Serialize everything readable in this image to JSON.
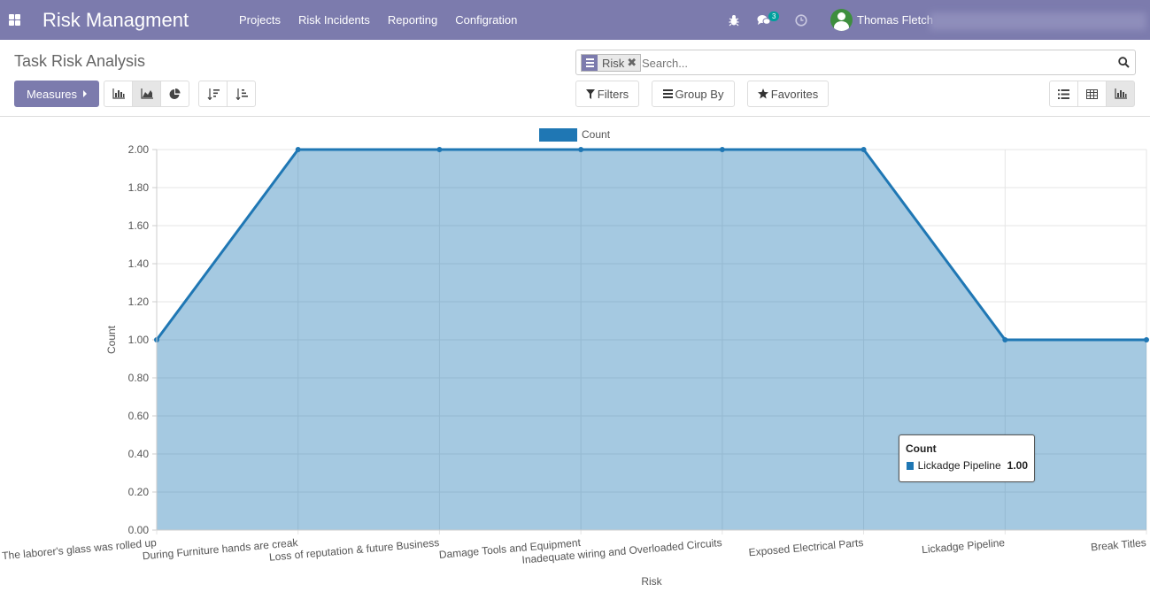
{
  "navbar": {
    "brand": "Risk Managment",
    "menu": [
      "Projects",
      "Risk Incidents",
      "Reporting",
      "Configration"
    ],
    "chat_count": "3",
    "user_name": "Thomas Fletch"
  },
  "control_panel": {
    "title": "Task Risk Analysis",
    "measures_label": "Measures",
    "search": {
      "facet": "Risk",
      "placeholder": "Search..."
    },
    "filters_label": "Filters",
    "groupby_label": "Group By",
    "favorites_label": "Favorites"
  },
  "chart_data": {
    "type": "area",
    "categories": [
      "The laborer's glass was rolled up",
      "During Furniture hands are creak",
      "Loss of reputation & future Business",
      "Damage Tools and Equipment",
      "Inadequate wiring and Overloaded Circuits",
      "Exposed Electrical Parts",
      "Lickadge Pipeline",
      "Break Titles"
    ],
    "series": [
      {
        "name": "Count",
        "values": [
          1,
          2,
          2,
          2,
          2,
          2,
          1,
          1
        ],
        "color": "#1f77b4"
      }
    ],
    "ylim": [
      0,
      2
    ],
    "yticks": [
      "0.00",
      "0.20",
      "0.40",
      "0.60",
      "0.80",
      "1.00",
      "1.20",
      "1.40",
      "1.60",
      "1.80",
      "2.00"
    ],
    "xlabel": "Risk",
    "ylabel": "Count",
    "legend": "top-center",
    "grid": true
  },
  "tooltip": {
    "title": "Count",
    "label": "Lickadge Pipeline",
    "value": "1.00"
  }
}
